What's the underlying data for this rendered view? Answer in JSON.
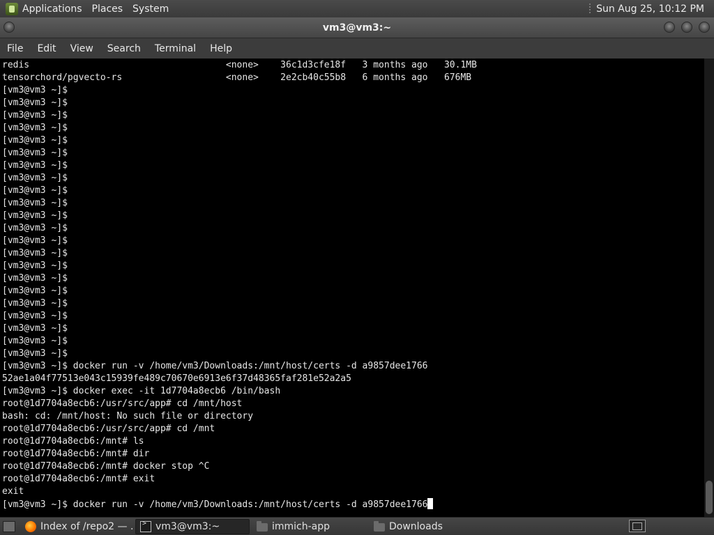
{
  "top_panel": {
    "menus": [
      "Applications",
      "Places",
      "System"
    ],
    "clock": "Sun Aug 25, 10:12 PM"
  },
  "window": {
    "title": "vm3@vm3:~"
  },
  "menubar": {
    "items": [
      "File",
      "Edit",
      "View",
      "Search",
      "Terminal",
      "Help"
    ]
  },
  "terminal": {
    "lines": [
      "redis                                    <none>    36c1d3cfe18f   3 months ago   30.1MB",
      "tensorchord/pgvecto-rs                   <none>    2e2cb40c55b8   6 months ago   676MB",
      "[vm3@vm3 ~]$",
      "[vm3@vm3 ~]$",
      "[vm3@vm3 ~]$",
      "[vm3@vm3 ~]$",
      "[vm3@vm3 ~]$",
      "[vm3@vm3 ~]$",
      "[vm3@vm3 ~]$",
      "[vm3@vm3 ~]$",
      "[vm3@vm3 ~]$",
      "[vm3@vm3 ~]$",
      "[vm3@vm3 ~]$",
      "[vm3@vm3 ~]$",
      "[vm3@vm3 ~]$",
      "[vm3@vm3 ~]$",
      "[vm3@vm3 ~]$",
      "[vm3@vm3 ~]$",
      "[vm3@vm3 ~]$",
      "[vm3@vm3 ~]$",
      "[vm3@vm3 ~]$",
      "[vm3@vm3 ~]$",
      "[vm3@vm3 ~]$",
      "[vm3@vm3 ~]$",
      "[vm3@vm3 ~]$ docker run -v /home/vm3/Downloads:/mnt/host/certs -d a9857dee1766",
      "52ae1a04f77513e043c15939fe489c70670e6913e6f37d48365faf281e52a2a5",
      "[vm3@vm3 ~]$ docker exec -it 1d7704a8ecb6 /bin/bash",
      "root@1d7704a8ecb6:/usr/src/app# cd /mnt/host",
      "bash: cd: /mnt/host: No such file or directory",
      "root@1d7704a8ecb6:/usr/src/app# cd /mnt",
      "root@1d7704a8ecb6:/mnt# ls",
      "root@1d7704a8ecb6:/mnt# dir",
      "root@1d7704a8ecb6:/mnt# docker stop ^C",
      "root@1d7704a8ecb6:/mnt# exit",
      "exit"
    ],
    "current_input": "[vm3@vm3 ~]$ docker run -v /home/vm3/Downloads:/mnt/host/certs -d a9857dee1766"
  },
  "taskbar": {
    "tasks": [
      {
        "label": "Index of /repo2 — ...",
        "icon": "firefox-icon"
      },
      {
        "label": "vm3@vm3:~",
        "icon": "terminal-icon"
      },
      {
        "label": "immich-app",
        "icon": "folder-icon"
      },
      {
        "label": "Downloads",
        "icon": "folder-icon"
      }
    ]
  }
}
